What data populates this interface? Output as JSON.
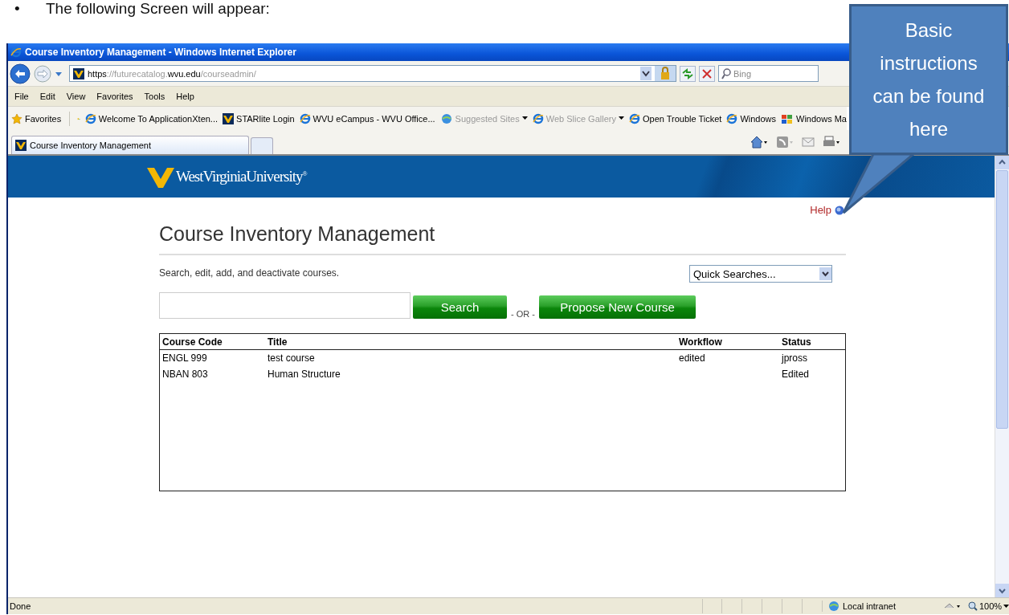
{
  "document": {
    "bullet": "•",
    "caption": "The following Screen will appear:"
  },
  "window": {
    "title": "Course Inventory Management - Windows Internet Explorer"
  },
  "address_bar": {
    "url": "**https**://futurecatalog.**wvu.edu**/courseadmin/",
    "search_placeholder": "Bing"
  },
  "menu": [
    "File",
    "Edit",
    "View",
    "Favorites",
    "Tools",
    "Help"
  ],
  "favorites_bar": {
    "label": "Favorites",
    "items": [
      {
        "label": "Welcome To ApplicationXten...",
        "kind": "ie",
        "disabled": false,
        "dropdown": false
      },
      {
        "label": "STARlite Login",
        "kind": "wvu",
        "disabled": false,
        "dropdown": false
      },
      {
        "label": "WVU eCampus - WVU Office...",
        "kind": "ie",
        "disabled": false,
        "dropdown": false
      },
      {
        "label": "Suggested Sites",
        "kind": "ie-globe",
        "disabled": true,
        "dropdown": true
      },
      {
        "label": "Web Slice Gallery",
        "kind": "ie",
        "disabled": true,
        "dropdown": true
      },
      {
        "label": "Open Trouble Ticket",
        "kind": "ie",
        "disabled": false,
        "dropdown": false
      },
      {
        "label": "Windows",
        "kind": "ie",
        "disabled": false,
        "dropdown": false
      },
      {
        "label": "Windows Ma",
        "kind": "flag",
        "disabled": false,
        "dropdown": false
      }
    ]
  },
  "tabs": [
    {
      "label": "Course Inventory Management",
      "selected": true
    }
  ],
  "page": {
    "logo": "WestVirginiaUniversity$^{®}$",
    "help": "Help",
    "heading": "Course Inventory Management",
    "subtitle": "Search, edit, add, and deactivate courses.",
    "quick_searches": "Quick Searches...",
    "search_button": "Search",
    "or": "- OR -",
    "propose_button": "Propose New Course",
    "table": {
      "columns": [
        "Course Code",
        "Title",
        "Workflow",
        "Status"
      ],
      "rows": [
        [
          "ENGL 999",
          "test course",
          "edited",
          "jpross"
        ],
        [
          "NBAN 803",
          "Human Structure",
          "",
          "Edited"
        ]
      ]
    }
  },
  "status_bar": {
    "text": "Done",
    "zone": "Local intranet",
    "zoom": "100%"
  },
  "callout": {
    "text": "Basic instructions can be found here"
  }
}
